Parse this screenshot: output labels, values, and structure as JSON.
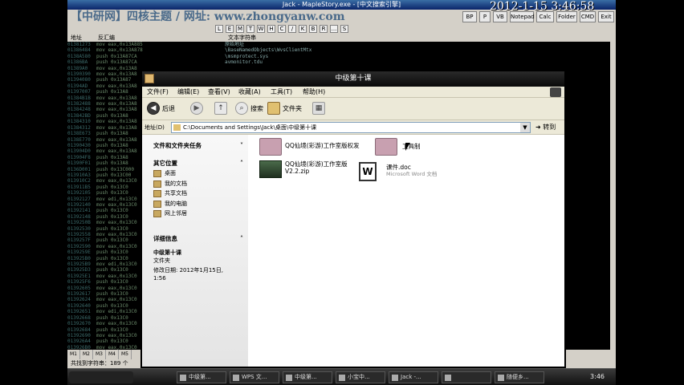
{
  "debugger": {
    "title": "Jack - MapleStory.exe - [中文搜索引擎]",
    "banner": "【中研网】四核主题 / 网址: www.zhongyanw.com",
    "toolbar_letters": [
      "L",
      "E",
      "M",
      "T",
      "W",
      "H",
      "C",
      "/",
      "K",
      "B",
      "R",
      "...",
      "S"
    ],
    "right_buttons": [
      "BP",
      "P",
      "VB",
      "Notepad",
      "Calc",
      "Folder",
      "CMD",
      "Exit"
    ],
    "col_address": "地址",
    "col_disasm": "反汇编",
    "col_text": "文本字符串",
    "code_lines": [
      [
        "01381273",
        "mov eax,0x13A885"
      ],
      [
        "01386484",
        "mov eax,0x13A878"
      ],
      [
        "0138A580",
        "push 0x13A87CA"
      ],
      [
        "01386BA",
        "push 0x13A87CA"
      ],
      [
        "01389A0",
        "mov eax,0x13A8"
      ],
      [
        "01390390",
        "mov eax,0x13A8"
      ],
      [
        "01394080",
        "push 0x13A87"
      ],
      [
        "01394AD",
        "mov eax,0x13A8"
      ],
      [
        "01397007",
        "push 0x13A8"
      ],
      [
        "01384B1B",
        "mov eax,0x13A8"
      ],
      [
        "01382488",
        "mov eax,0x13A8"
      ],
      [
        "01384248",
        "mov eax,0x13A8"
      ],
      [
        "013842BD",
        "push 0x13A8"
      ],
      [
        "01384310",
        "mov eax,0x13A8"
      ],
      [
        "01384312",
        "mov eax,0x13A8"
      ],
      [
        "0138E673",
        "push 0x13A8"
      ],
      [
        "0138E770",
        "mov eax,0x13A8"
      ],
      [
        "01390430",
        "push 0x13A8"
      ],
      [
        "013904D0",
        "mov eax,0x13A8"
      ],
      [
        "013904F8",
        "push 0x13A8"
      ],
      [
        "01390F01",
        "push 0x13A8"
      ],
      [
        "0136D001",
        "push 0x13C000"
      ],
      [
        "013910A3",
        "push 0x13C00"
      ],
      [
        "013910C2",
        "mov eax,0x13C0"
      ],
      [
        "013911B5",
        "push 0x13C0"
      ],
      [
        "01392105",
        "push 0x13C0"
      ],
      [
        "01392127",
        "mov edi,0x13C0"
      ],
      [
        "01392140",
        "mov eax,0x13C0"
      ],
      [
        "01392141",
        "push 0x13C0"
      ],
      [
        "01392148",
        "push 0x13C0"
      ],
      [
        "0139250B",
        "mov eax,0x13C0"
      ],
      [
        "01392530",
        "push 0x13C0"
      ],
      [
        "01392558",
        "mov eax,0x13C0"
      ],
      [
        "0139257F",
        "push 0x13C0"
      ],
      [
        "01392590",
        "mov eax,0x13C0"
      ],
      [
        "0139259E",
        "push 0x13C0"
      ],
      [
        "013925B0",
        "push 0x13C0"
      ],
      [
        "013925B9",
        "mov edi,0x13C0"
      ],
      [
        "013925D3",
        "push 0x13C0"
      ],
      [
        "013925E1",
        "mov eax,0x13C0"
      ],
      [
        "013925F6",
        "push 0x13C0"
      ],
      [
        "01392605",
        "mov eax,0x13C0"
      ],
      [
        "01392617",
        "push 0x13C0"
      ],
      [
        "01392624",
        "mov eax,0x13C0"
      ],
      [
        "01392640",
        "push 0x13C0"
      ],
      [
        "01392651",
        "mov edi,0x13C0"
      ],
      [
        "01392668",
        "push 0x13C0"
      ],
      [
        "01392670",
        "mov eax,0x13C0"
      ],
      [
        "01392684",
        "push 0x13C0"
      ],
      [
        "01392690",
        "mov eax,0x13C0"
      ],
      [
        "013926A4",
        "push 0x13C0"
      ],
      [
        "013926B0",
        "mov eax,0x13C0"
      ]
    ],
    "comment_lines": [
      "原始地址",
      "\\BaseNamedObjects\\WvsClientMtx",
      "\\msmprotect.sys",
      "avmonitor.tdu"
    ],
    "stack_tabs": [
      "M1",
      "M2",
      "M3",
      "M4",
      "M5"
    ],
    "status": "共找到字符串：189 个"
  },
  "clock": "2012-1-15 3:46:58",
  "explorer": {
    "title": "中级第十课",
    "menu": [
      "文件(F)",
      "编辑(E)",
      "查看(V)",
      "收藏(A)",
      "工具(T)",
      "帮助(H)"
    ],
    "toolbar": {
      "back": "后退",
      "search": "搜索",
      "folders": "文件夹"
    },
    "address_label": "地址(D)",
    "address": "C:\\Documents and Settings\\Jack\\桌面\\中级第十课",
    "go": "转到",
    "tasks": {
      "title": "文件和文件夹任务"
    },
    "places": {
      "title": "其它位置",
      "items": [
        "桌面",
        "我的文档",
        "共享文档",
        "我的电脑",
        "网上邻居"
      ]
    },
    "details": {
      "title": "详细信息",
      "name": "中级第十课",
      "type": "文件夹",
      "modified": "修改日期: 2012年1月15日, 1:56"
    },
    "files": [
      {
        "name": "QQ仙境(彩游)工作室版权发",
        "sub": ""
      },
      {
        "name": "工具制",
        "sub": ""
      },
      {
        "name": "QQ仙境(彩游)工作室版",
        "sub": "V2.2.zip"
      },
      {
        "name": "课件.doc",
        "sub": "Microsoft Word 文档"
      }
    ]
  },
  "taskbar": {
    "tasks": [
      "中级第...",
      "WPS 文...",
      "中级第...",
      "小宝中...",
      "Jack -...",
      "",
      "随便乡..."
    ],
    "time": "3:46"
  }
}
